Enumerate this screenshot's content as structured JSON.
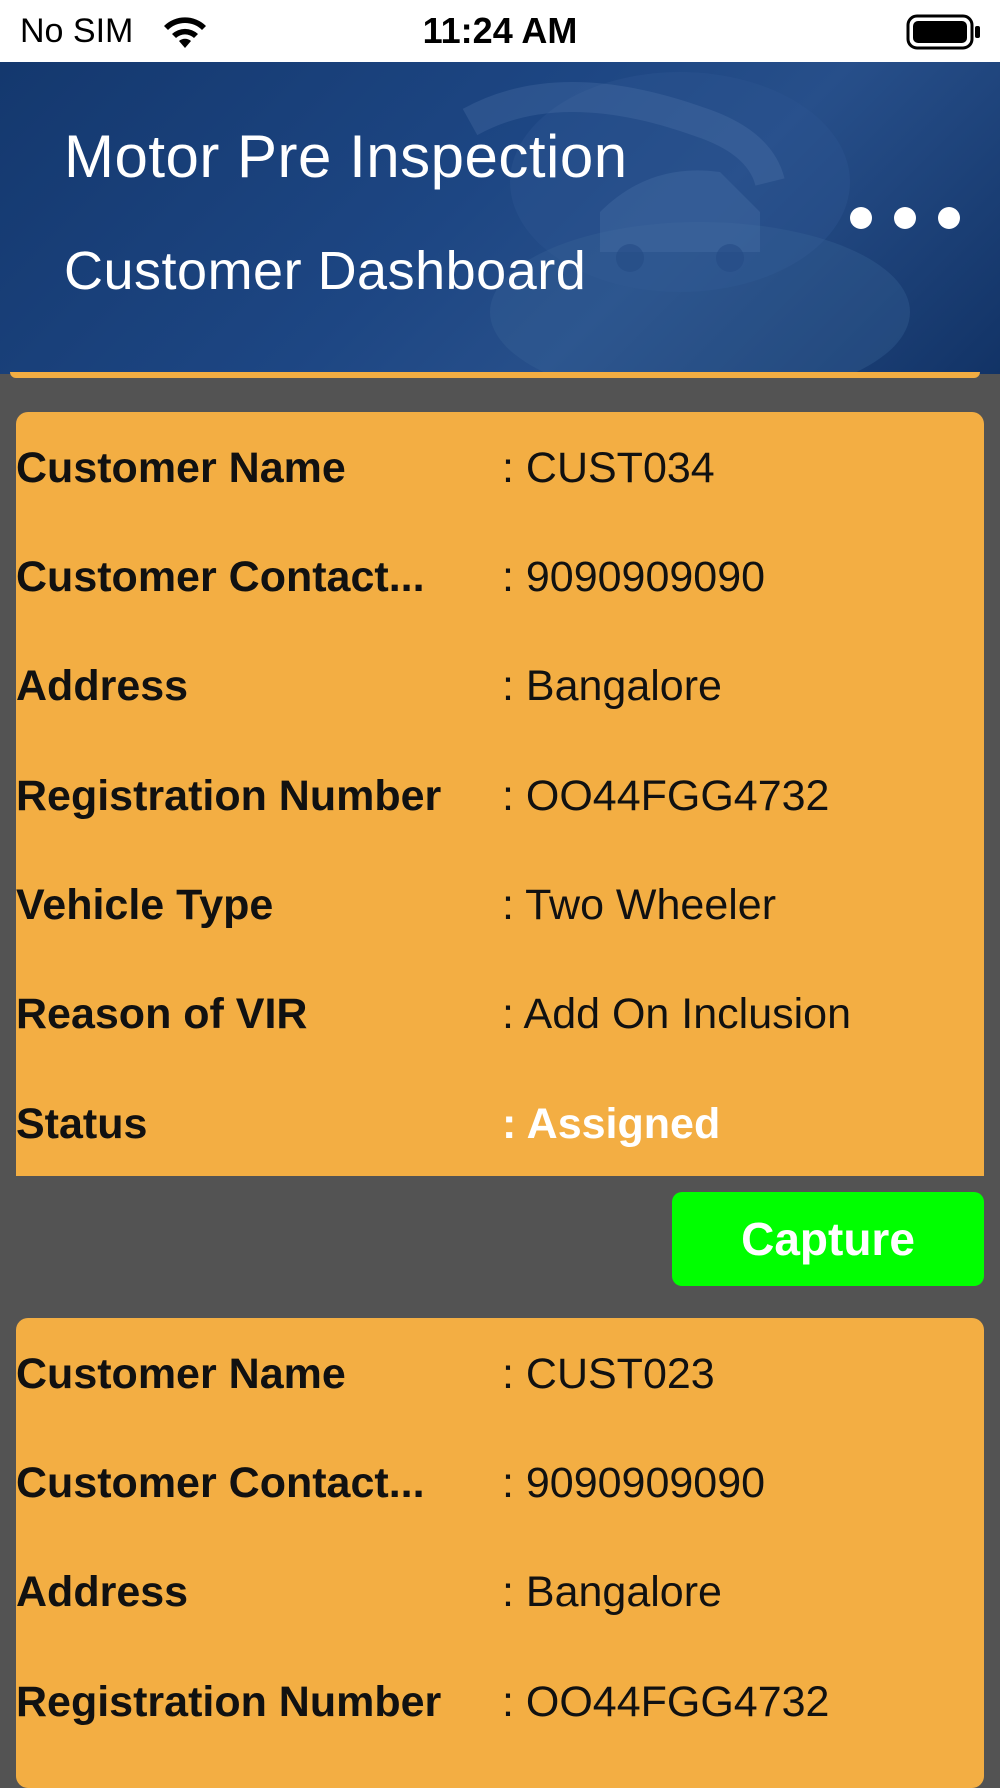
{
  "status_bar": {
    "carrier": "No SIM",
    "time": "11:24 AM"
  },
  "header": {
    "title": "Motor Pre Inspection",
    "subtitle": "Customer Dashboard",
    "menu_icon": "more-horizontal-icon"
  },
  "colors": {
    "header": "#1d4683",
    "card": "#f3ae43",
    "background": "#535353",
    "capture": "#00ff00"
  },
  "records": [
    {
      "fields": [
        {
          "label": "Customer Name",
          "value": ": CUST034"
        },
        {
          "label": "Customer Contact...",
          "value": ": 9090909090"
        },
        {
          "label": "Address",
          "value": ": Bangalore"
        },
        {
          "label": "Registration Number",
          "value": ": OO44FGG4732"
        },
        {
          "label": "Vehicle Type",
          "value": ": Two Wheeler"
        },
        {
          "label": "Reason of VIR",
          "value": ": Add On Inclusion"
        },
        {
          "label": "Status",
          "value": ": Assigned"
        }
      ],
      "action_label": "Capture"
    },
    {
      "fields": [
        {
          "label": "Customer Name",
          "value": ": CUST023"
        },
        {
          "label": "Customer Contact...",
          "value": ": 9090909090"
        },
        {
          "label": "Address",
          "value": ": Bangalore"
        },
        {
          "label": "Registration Number",
          "value": ": OO44FGG4732"
        }
      ]
    }
  ]
}
